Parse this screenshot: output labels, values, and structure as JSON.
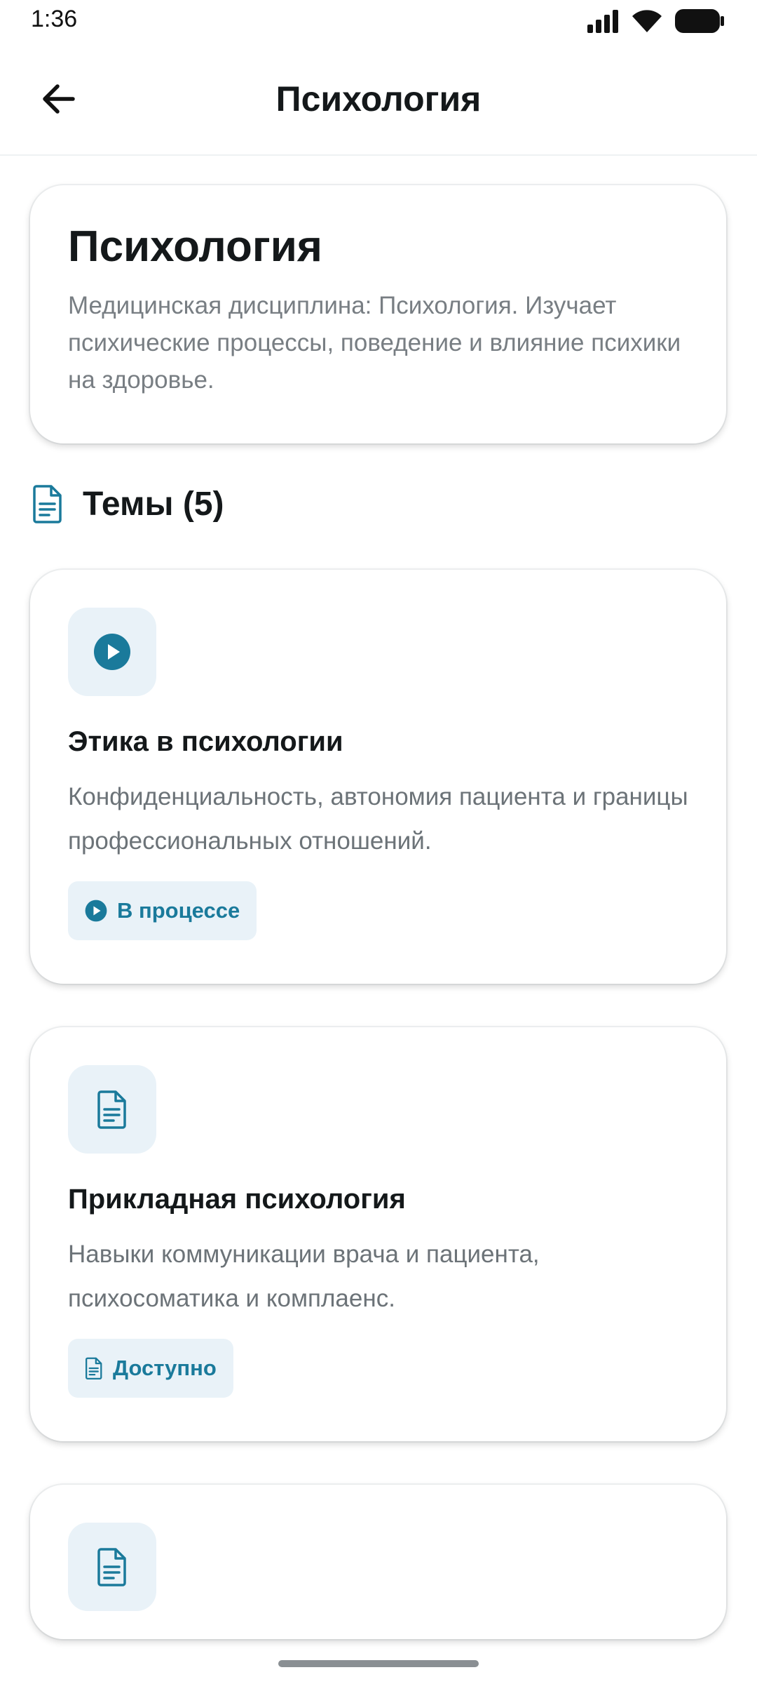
{
  "status_bar": {
    "time": "1:36",
    "icons": [
      "signal-icon",
      "wifi-icon",
      "battery-icon"
    ]
  },
  "app_bar": {
    "title": "Психология",
    "back_icon": "arrow-left-icon"
  },
  "discipline": {
    "title": "Психология",
    "description": "Медицинская дисциплина: Психология. Изучает психические процессы, поведение и влияние психики на здоровье."
  },
  "topics_section": {
    "title": "Темы (5)",
    "icon": "document-icon"
  },
  "topics": [
    {
      "icon": "play-circle-icon",
      "title": "Этика в психологии",
      "description": "Конфиденциальность, автономия пациента и границы профессиональных отношений.",
      "status": "В процессе",
      "status_icon": "play-circle-icon"
    },
    {
      "icon": "document-icon",
      "title": "Прикладная психология",
      "description": "Навыки коммуникации врача и пациента, психосоматика и комплаенс.",
      "status": "Доступно",
      "status_icon": "document-icon"
    },
    {
      "icon": "document-icon"
    }
  ],
  "colors": {
    "accent": "#1a7a9b",
    "badge_bg": "#e9f2f8",
    "text_primary": "#14181a",
    "text_secondary": "#6c7378"
  }
}
